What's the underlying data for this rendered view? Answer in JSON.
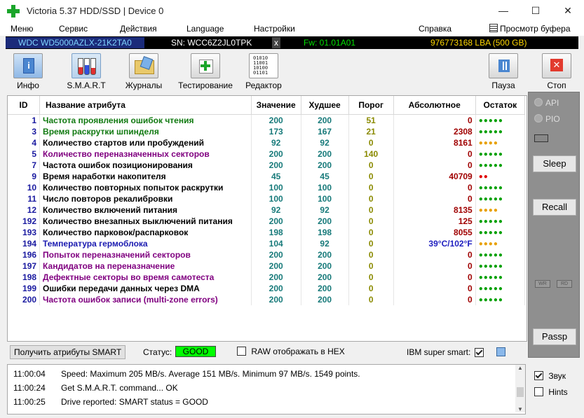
{
  "window": {
    "title": "Victoria 5.37 HDD/SSD | Device 0",
    "minimize": "—",
    "maximize": "☐",
    "close": "✕"
  },
  "menu": {
    "items": [
      "Меню",
      "Сервис",
      "Действия",
      "Language",
      "Настройки",
      "Справка"
    ],
    "buffer_view": "Просмотр буфера"
  },
  "device": {
    "model": "WDC WD5000AZLX-21K2TA0",
    "serial": "SN: WCC6Z2JL0TPK",
    "x": "x",
    "firmware": "Fw: 01.01A01",
    "lba": "976773168 LBA (500 GB)"
  },
  "toolbar": {
    "info": "Инфо",
    "smart": "S.M.A.R.T",
    "logs": "Журналы",
    "test": "Тестирование",
    "editor": "Редактор",
    "pause": "Пауза",
    "stop": "Стоп"
  },
  "table": {
    "headers": [
      "ID",
      "Название атрибута",
      "Значение",
      "Худшее",
      "Порог",
      "Абсолютное",
      "Остаток"
    ],
    "rows": [
      {
        "id": "1",
        "name": "Частота проявления ошибок чтения",
        "value": "200",
        "worst": "200",
        "thr": "51",
        "abs": "0",
        "dots": "●●●●●",
        "name_color": "green",
        "dot_color": "#00a000"
      },
      {
        "id": "3",
        "name": "Время раскрутки шпинделя",
        "value": "173",
        "worst": "167",
        "thr": "21",
        "abs": "2308",
        "dots": "●●●●●",
        "name_color": "green",
        "dot_color": "#00a000"
      },
      {
        "id": "4",
        "name": "Количество стартов или пробуждений",
        "value": "92",
        "worst": "92",
        "thr": "0",
        "abs": "8161",
        "dots": "●●●●",
        "name_color": "black",
        "dot_color": "#e8a000"
      },
      {
        "id": "5",
        "name": "Количество переназначенных секторов",
        "value": "200",
        "worst": "200",
        "thr": "140",
        "abs": "0",
        "dots": "●●●●●",
        "name_color": "purple",
        "dot_color": "#00a000"
      },
      {
        "id": "7",
        "name": "Частота ошибок позиционирования",
        "value": "200",
        "worst": "200",
        "thr": "0",
        "abs": "0",
        "dots": "●●●●●",
        "name_color": "black",
        "dot_color": "#00a000"
      },
      {
        "id": "9",
        "name": "Время наработки накопителя",
        "value": "45",
        "worst": "45",
        "thr": "0",
        "abs": "40709",
        "dots": "●●",
        "name_color": "black",
        "dot_color": "#e00000"
      },
      {
        "id": "10",
        "name": "Количество повторных попыток раскрутки",
        "value": "100",
        "worst": "100",
        "thr": "0",
        "abs": "0",
        "dots": "●●●●●",
        "name_color": "black",
        "dot_color": "#00a000"
      },
      {
        "id": "11",
        "name": "Число повторов рекалибровки",
        "value": "100",
        "worst": "100",
        "thr": "0",
        "abs": "0",
        "dots": "●●●●●",
        "name_color": "black",
        "dot_color": "#00a000"
      },
      {
        "id": "12",
        "name": "Количество включений питания",
        "value": "92",
        "worst": "92",
        "thr": "0",
        "abs": "8135",
        "dots": "●●●●",
        "name_color": "black",
        "dot_color": "#e8a000"
      },
      {
        "id": "192",
        "name": "Количество внезапных выключений питания",
        "value": "200",
        "worst": "200",
        "thr": "0",
        "abs": "125",
        "dots": "●●●●●",
        "name_color": "black",
        "dot_color": "#00a000"
      },
      {
        "id": "193",
        "name": "Количество парковок/распарковок",
        "value": "198",
        "worst": "198",
        "thr": "0",
        "abs": "8055",
        "dots": "●●●●●",
        "name_color": "black",
        "dot_color": "#00a000"
      },
      {
        "id": "194",
        "name": "Температура гермоблока",
        "value": "104",
        "worst": "92",
        "thr": "0",
        "abs": "39°C/102°F",
        "dots": "●●●●",
        "name_color": "blue",
        "dot_color": "#e8a000",
        "abs_blue": true
      },
      {
        "id": "196",
        "name": "Попыток переназначений секторов",
        "value": "200",
        "worst": "200",
        "thr": "0",
        "abs": "0",
        "dots": "●●●●●",
        "name_color": "purple",
        "dot_color": "#00a000"
      },
      {
        "id": "197",
        "name": "Кандидатов на переназначение",
        "value": "200",
        "worst": "200",
        "thr": "0",
        "abs": "0",
        "dots": "●●●●●",
        "name_color": "purple",
        "dot_color": "#00a000"
      },
      {
        "id": "198",
        "name": "Дефектные секторы во время самотеста",
        "value": "200",
        "worst": "200",
        "thr": "0",
        "abs": "0",
        "dots": "●●●●●",
        "name_color": "purple",
        "dot_color": "#00a000"
      },
      {
        "id": "199",
        "name": "Ошибки передачи данных через DMA",
        "value": "200",
        "worst": "200",
        "thr": "0",
        "abs": "0",
        "dots": "●●●●●",
        "name_color": "black",
        "dot_color": "#00a000"
      },
      {
        "id": "200",
        "name": "Частота ошибок записи (multi-zone errors)",
        "value": "200",
        "worst": "200",
        "thr": "0",
        "abs": "0",
        "dots": "●●●●●",
        "name_color": "purple",
        "dot_color": "#00a000"
      }
    ]
  },
  "side": {
    "api": "API",
    "pio": "PIO",
    "sleep": "Sleep",
    "recall": "Recall",
    "wr": "WR",
    "rd": "RD",
    "passp": "Passp"
  },
  "status": {
    "get_button": "Получить атрибуты SMART",
    "label": "Статус:",
    "value": "GOOD",
    "raw_hex": "RAW отображать в HEX",
    "ibm": "IBM super smart:"
  },
  "log": [
    {
      "time": "11:00:04",
      "text": "Speed: Maximum 205 MB/s. Average 151 MB/s. Minimum 97 MB/s. 1549 points."
    },
    {
      "time": "11:00:24",
      "text": "Get S.M.A.R.T. command... OK"
    },
    {
      "time": "11:00:25",
      "text": "Drive reported: SMART status = GOOD"
    }
  ],
  "options": {
    "sound": "Звук",
    "hints": "Hints"
  }
}
